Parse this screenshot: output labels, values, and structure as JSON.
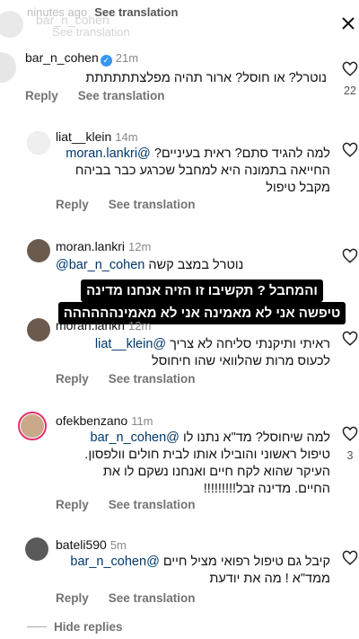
{
  "top": {
    "ghost_left": "ninutes ago",
    "ghost_bold": "See translation",
    "ghost_name": "bar_n_cohen",
    "ghost_trans": "See translation"
  },
  "comments": [
    {
      "username": "bar_n_cohen",
      "time": "21m",
      "text": "נוטרל? או חוסל? ארור תהיה מפלצתתתתתת",
      "reply": "Reply",
      "translate": "See translation",
      "likes": "22"
    },
    {
      "username": "liat__klein",
      "time": "14m",
      "text_line1": "למה להגיד סתם? ראית בעיניים?",
      "mention": "@moran.lankri",
      "text_line2": "החייאה בתמונה היא למחבל שכרגע כבר בביהח",
      "text_line3": "מקבל טיפול",
      "reply": "Reply",
      "translate": "See translation"
    },
    {
      "username": "moran.lankri",
      "time": "12m",
      "mention": "@bar_n_cohen",
      "text": "נוטרל במצב קשה",
      "reply": "Reply",
      "translate": "See translation"
    },
    {
      "username": "moran.lankri",
      "time": "12m",
      "mention": "@liat__klein",
      "text_line1": "ראיתי ותיקנתי סליחה לא צריך",
      "text_line2": "לכעוס מרות שהלוואי שהו חיחוסל",
      "reply": "Reply",
      "translate": "See translation"
    },
    {
      "username": "ofekbenzano",
      "time": "11m",
      "text_line1": "למה שיחוסל? מד\"א נתנו לו",
      "mention": "@bar_n_cohen",
      "text_line2": "טיפול ראשוני והובילו אותו לבית חולים וולפסון.",
      "text_line3": "העיקר שהוא לקח חיים ואנחנו נשקם לו את",
      "text_line4": "החיים. מדינה זבל!!!!!!!!!",
      "reply": "Reply",
      "translate": "See translation",
      "likes": "3"
    },
    {
      "username": "bateli590",
      "time": "5m",
      "text_line1": "קיבל גם טיפול רפואי מציל חיים",
      "mention": "@bar_n_cohen",
      "text_line2": "ממד\"א ! מה את יודעת",
      "reply": "Reply",
      "translate": "See translation"
    }
  ],
  "overlay": {
    "line1": "והמחבל ? תקשיבו זו הזיה אנחנו מדינה",
    "line2": "טיפשה אני לא מאמינה אני לא מאמינהההההה"
  },
  "hide_replies": "Hide replies",
  "colors": {
    "mention": "#00376b",
    "verified": "#3897f0",
    "ring": "#e1306c",
    "muted": "#737373"
  }
}
